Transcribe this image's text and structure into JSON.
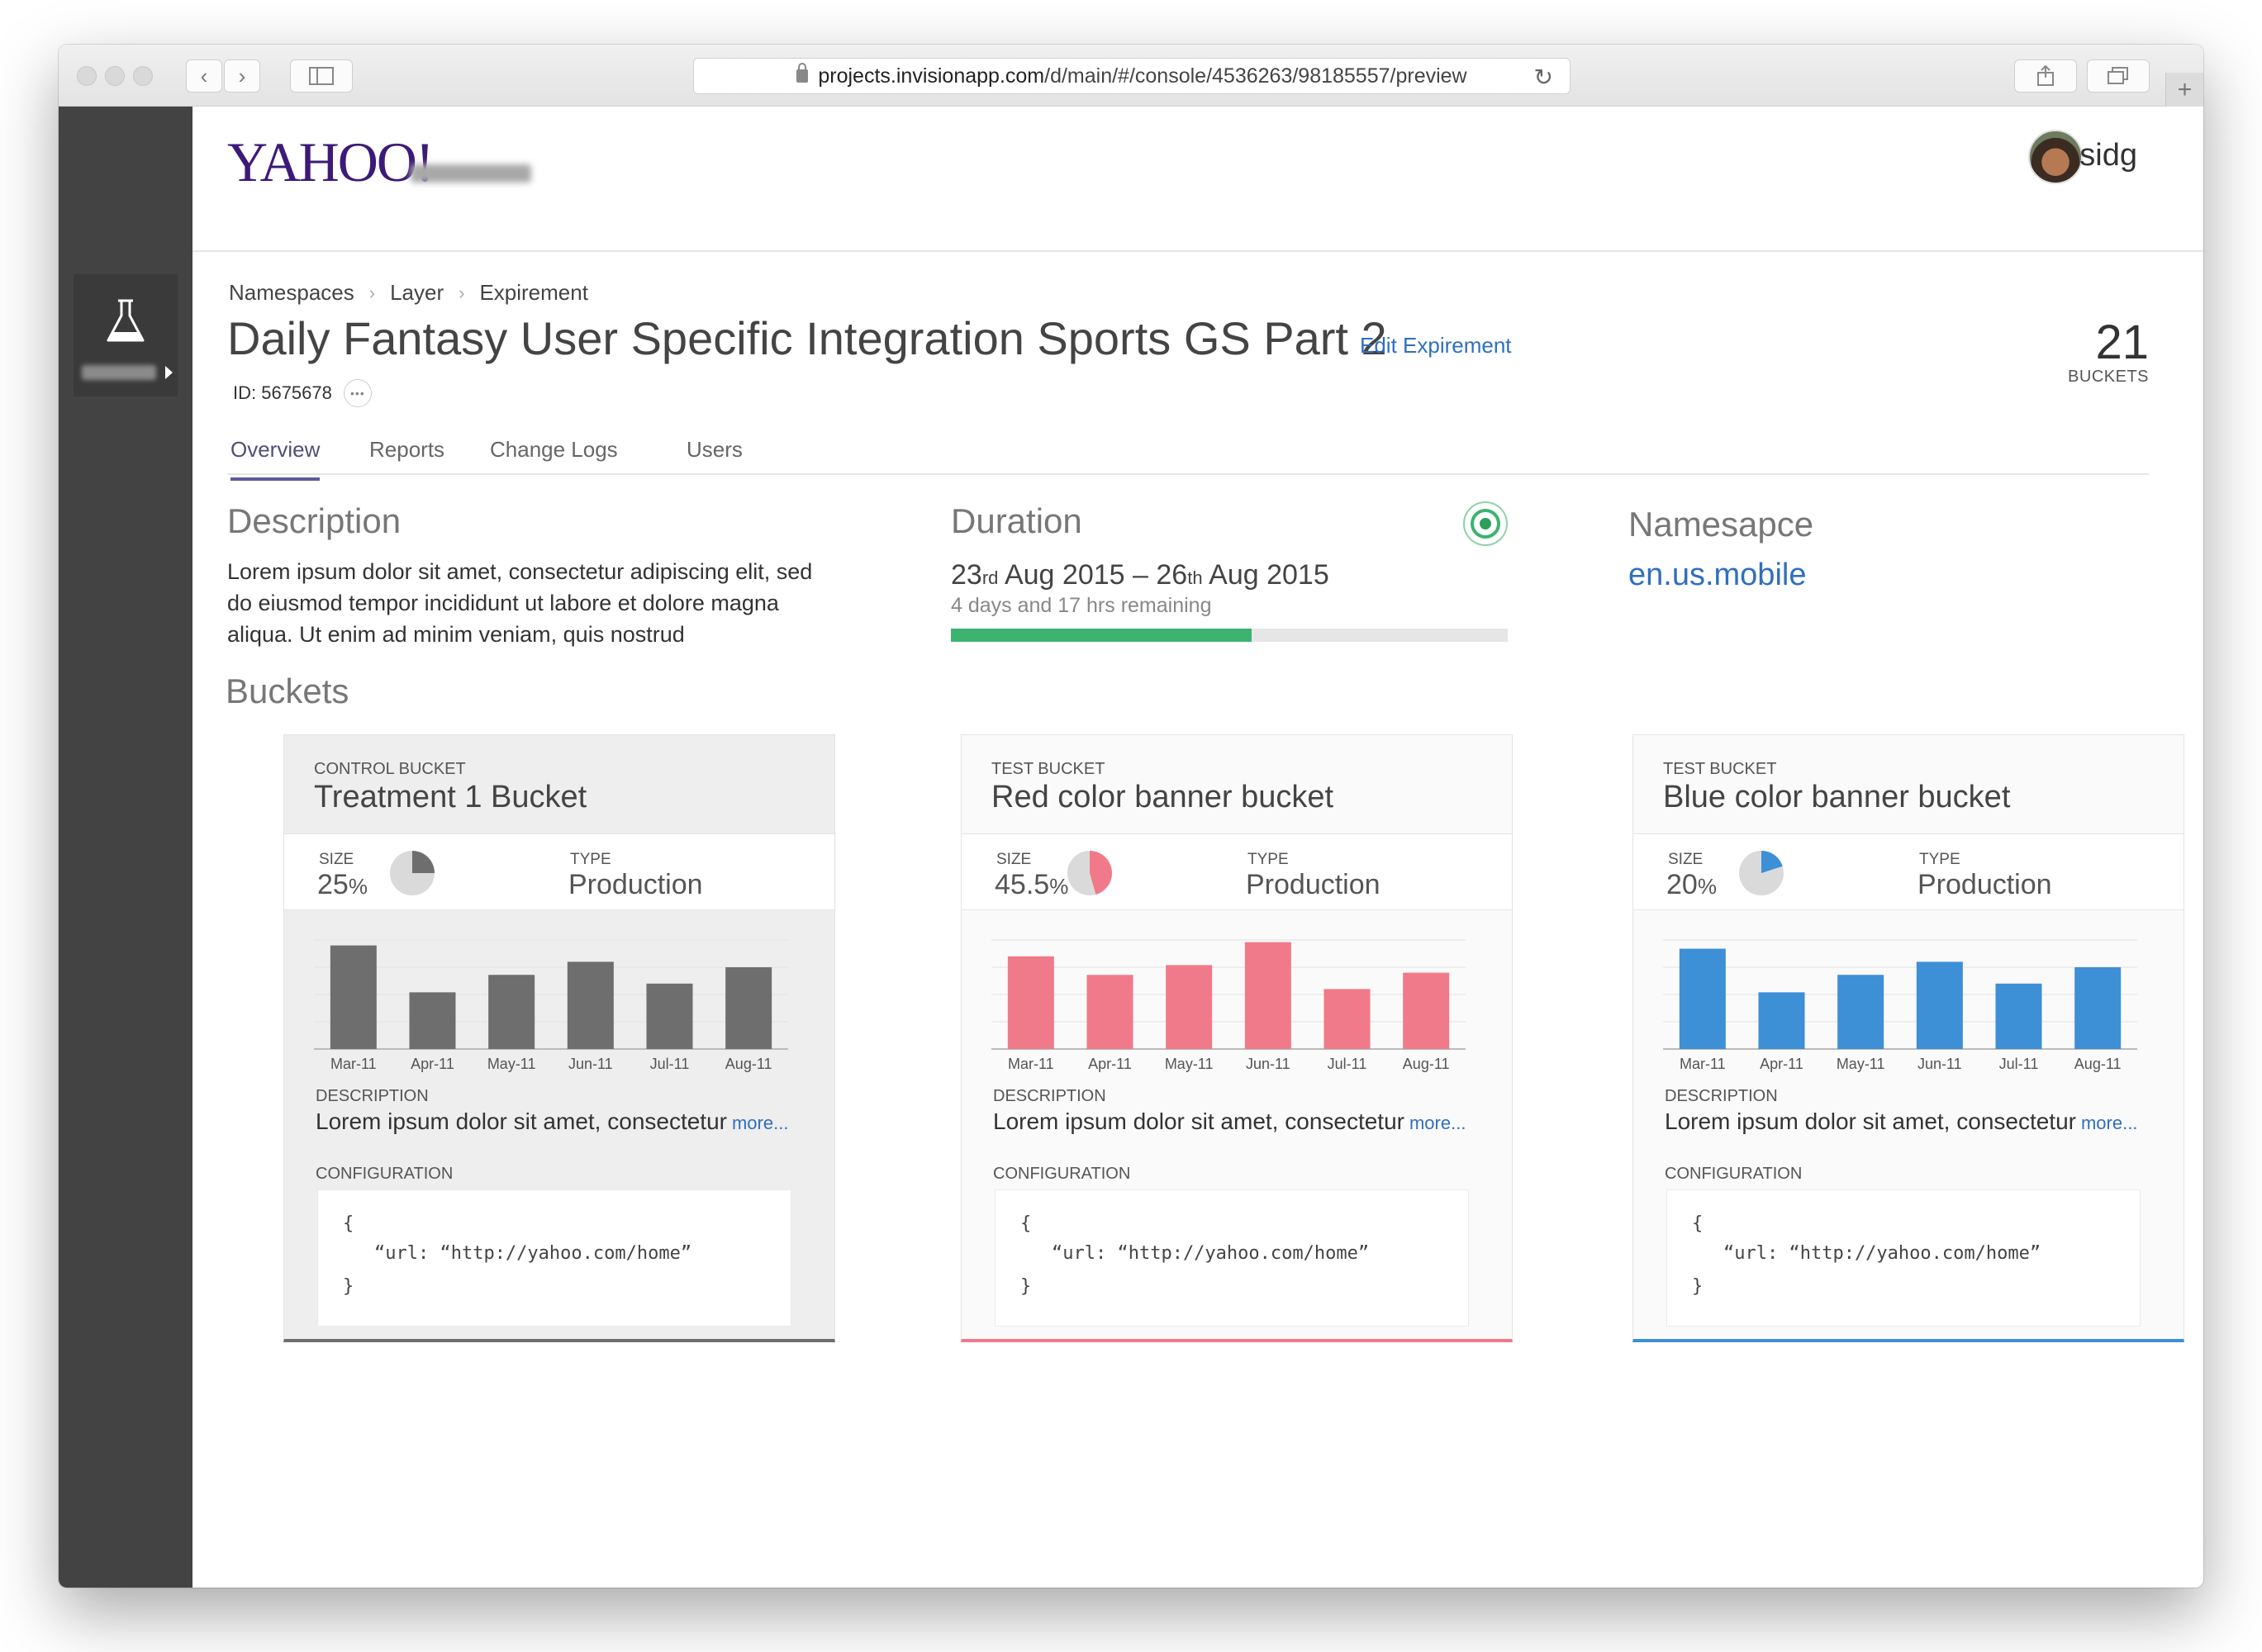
{
  "browser": {
    "url_host": "projects.invisionapp.com",
    "url_path": "/d/main/#/console/4536263/98185557/preview"
  },
  "header": {
    "logo": "YAHOO!",
    "username": "sidg"
  },
  "breadcrumb": [
    "Namespaces",
    "Layer",
    "Expirement"
  ],
  "page": {
    "title": "Daily Fantasy User Specific Integration Sports GS Part 2",
    "edit_link": "Edit Expirement",
    "id_text": "ID: 5675678",
    "bucket_count": "21",
    "bucket_count_label": "BUCKETS"
  },
  "tabs": [
    {
      "label": "Overview",
      "active": true
    },
    {
      "label": "Reports",
      "active": false
    },
    {
      "label": "Change Logs",
      "active": false
    },
    {
      "label": "Users",
      "active": false
    }
  ],
  "description": {
    "heading": "Description",
    "text": "Lorem ipsum dolor sit amet, consectetur adipiscing elit, sed do eiusmod tempor incididunt ut labore et dolore magna aliqua. Ut enim ad minim veniam, quis nostrud"
  },
  "duration": {
    "heading": "Duration",
    "start_day": "23",
    "start_suffix": "rd",
    "start_rest": "Aug 2015",
    "dash": "–",
    "end_day": "26",
    "end_suffix": "th",
    "end_rest": "Aug 2015",
    "remaining": "4 days and 17 hrs remaining",
    "progress": 0.54,
    "progress_color": "#3cb371"
  },
  "namespace": {
    "heading": "Namesapce",
    "value": "en.us.mobile"
  },
  "buckets_heading": "Buckets",
  "cards": [
    {
      "kind": "CONTROL BUCKET",
      "name": "Treatment 1 Bucket",
      "size_label": "SIZE",
      "size_value": "25",
      "size_unit": "%",
      "size_fraction": 0.25,
      "type_label": "TYPE",
      "type_value": "Production",
      "color": "#6e6e6e",
      "desc_label": "DESCRIPTION",
      "desc": "Lorem ipsum dolor sit amet, consectetur",
      "more": "more...",
      "config_label": "CONFIGURATION",
      "config_open": "{",
      "config_line": "“url: “http://yahoo.com/home”",
      "config_close": "}"
    },
    {
      "kind": "TEST BUCKET",
      "name": "Red color banner bucket",
      "size_label": "SIZE",
      "size_value": "45.5",
      "size_unit": "%",
      "size_fraction": 0.455,
      "type_label": "TYPE",
      "type_value": "Production",
      "color": "#f17a8a",
      "desc_label": "DESCRIPTION",
      "desc": "Lorem ipsum dolor sit amet, consectetur",
      "more": "more...",
      "config_label": "CONFIGURATION",
      "config_open": "{",
      "config_line": "“url: “http://yahoo.com/home”",
      "config_close": "}"
    },
    {
      "kind": "TEST BUCKET",
      "name": "Blue color banner bucket",
      "size_label": "SIZE",
      "size_value": "20",
      "size_unit": "%",
      "size_fraction": 0.2,
      "type_label": "TYPE",
      "type_value": "Production",
      "color": "#3d8fd6",
      "desc_label": "DESCRIPTION",
      "desc": "Lorem ipsum dolor sit amet, consectetur",
      "more": "more...",
      "config_label": "CONFIGURATION",
      "config_open": "{",
      "config_line": "“url: “http://yahoo.com/home”",
      "config_close": "}"
    }
  ],
  "chart_data": [
    {
      "type": "bar",
      "categories": [
        "Mar-11",
        "Apr-11",
        "May-11",
        "Jun-11",
        "Jul-11",
        "Aug-11"
      ],
      "values": [
        95,
        52,
        68,
        80,
        60,
        75
      ],
      "ylim": [
        0,
        100
      ],
      "color": "#6e6e6e"
    },
    {
      "type": "bar",
      "categories": [
        "Mar-11",
        "Apr-11",
        "May-11",
        "Jun-11",
        "Jul-11",
        "Aug-11"
      ],
      "values": [
        85,
        68,
        77,
        98,
        55,
        70
      ],
      "ylim": [
        0,
        100
      ],
      "color": "#f17a8a"
    },
    {
      "type": "bar",
      "categories": [
        "Mar-11",
        "Apr-11",
        "May-11",
        "Jun-11",
        "Jul-11",
        "Aug-11"
      ],
      "values": [
        92,
        52,
        68,
        80,
        60,
        75
      ],
      "ylim": [
        0,
        100
      ],
      "color": "#3d8fd6"
    }
  ]
}
